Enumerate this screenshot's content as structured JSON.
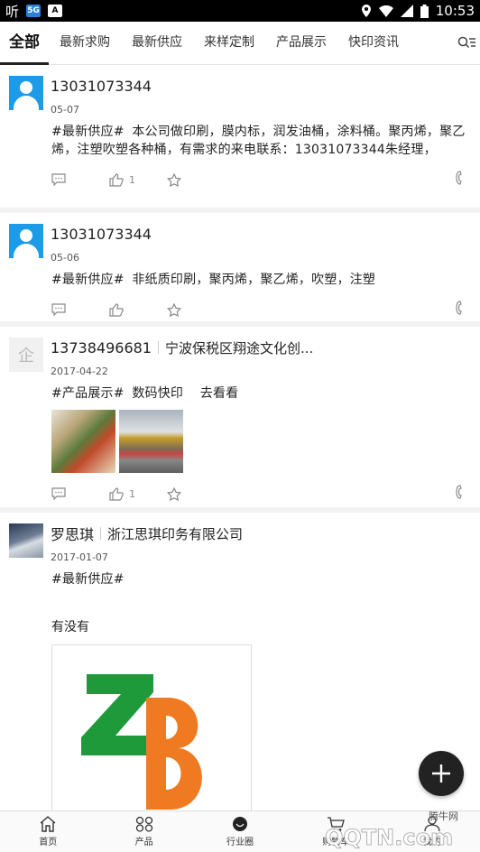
{
  "status_bar": {
    "app_text": "听",
    "box1": "5G",
    "box2": "A",
    "time": "10:53"
  },
  "tabs": [
    {
      "label": "全部",
      "active": true
    },
    {
      "label": "最新求购"
    },
    {
      "label": "最新供应"
    },
    {
      "label": "来样定制"
    },
    {
      "label": "产品展示"
    },
    {
      "label": "快印资讯"
    }
  ],
  "posts": [
    {
      "name": "13031073344",
      "company": "",
      "date": "05-07",
      "tag": "#最新供应#",
      "content": "本公司做印刷，膜内标，润发油桶，涂料桶。聚丙烯，聚乙烯，注塑吹塑各种桶，有需求的来电联系：13031073344朱经理，",
      "likes": "1"
    },
    {
      "name": "13031073344",
      "company": "",
      "date": "05-06",
      "tag": "#最新供应#",
      "content": "非纸质印刷，聚丙烯，聚乙烯，吹塑，注塑",
      "likes": ""
    },
    {
      "name": "13738496681",
      "company": "宁波保税区翔途文化创...",
      "date": "2017-04-22",
      "tag": "#产品展示#",
      "content": "数码快印    去看看",
      "likes": "1"
    },
    {
      "name": "罗思琪",
      "company": "浙江思琪印务有限公司",
      "date": "2017-01-07",
      "tag": "#最新供应#",
      "content": "",
      "extra_text": "有没有",
      "likes": ""
    }
  ],
  "avatar_placeholder": "企",
  "bottom_nav": [
    {
      "label": "首页"
    },
    {
      "label": "产品"
    },
    {
      "label": "行业圈"
    },
    {
      "label": "购物车"
    },
    {
      "label": "我的"
    }
  ],
  "watermark_text": "腾牛网",
  "watermark_logo": "QQTN.com",
  "colors": {
    "avatar_blue": "#1e9be7",
    "zb_green": "#1f9a3a",
    "zb_orange": "#ef7a22"
  }
}
